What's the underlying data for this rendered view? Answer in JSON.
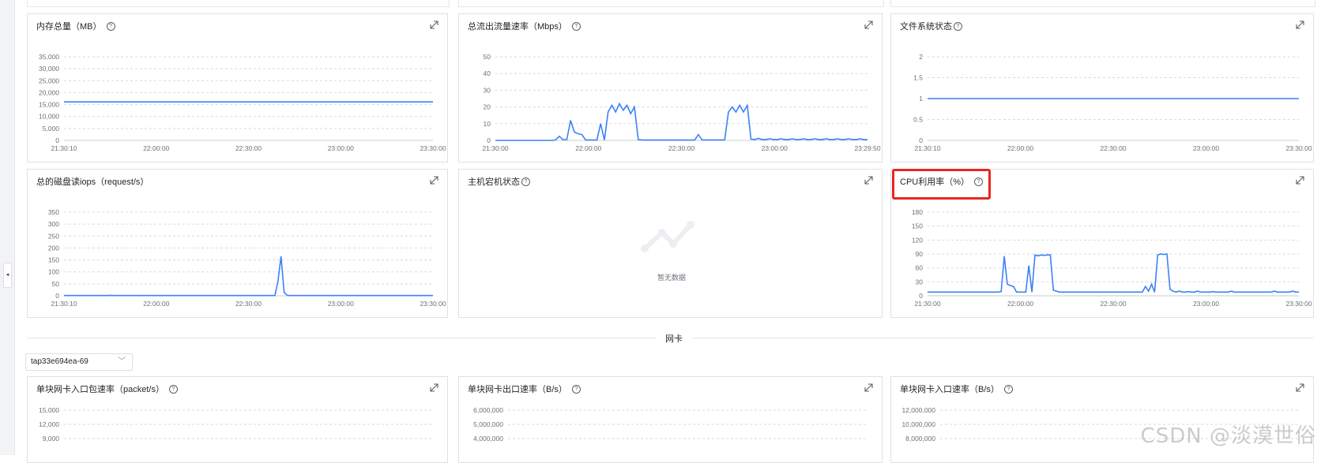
{
  "colors": {
    "line": "#3b82f6",
    "highlight": "#e8261f"
  },
  "section": {
    "label": "网卡"
  },
  "nic_select": {
    "value": "tap33e694ea-69"
  },
  "watermark": {
    "text": "CSDN @淡漠世俗"
  },
  "charts": {
    "memory": {
      "title": "内存总量（MB）",
      "chart_data": {
        "type": "line",
        "yticks": [
          "35,000",
          "30,000",
          "25,000",
          "20,000",
          "15,000",
          "10,000",
          "5,000",
          "0"
        ],
        "xticks": [
          "21:30:10",
          "22:00:00",
          "22:30:00",
          "23:00:00",
          "23:30:00"
        ],
        "ylim": [
          0,
          35000
        ],
        "values": [
          16100,
          16100,
          16100,
          16100,
          16100,
          16100,
          16100,
          16100,
          16100,
          16100
        ]
      }
    },
    "flow_out": {
      "title": "总流出流量速率（Mbps）",
      "chart_data": {
        "type": "line",
        "yticks": [
          "50",
          "40",
          "30",
          "20",
          "10",
          "0"
        ],
        "xticks": [
          "21:30:00",
          "22:00:00",
          "22:30:00",
          "23:00:00",
          "23:29:50"
        ],
        "ylim": [
          0,
          50
        ],
        "values": [
          0,
          0,
          0,
          0,
          0,
          0,
          0,
          0,
          0,
          0,
          0,
          0,
          0,
          0,
          0,
          0,
          0.3,
          2.5,
          0.4,
          0.5,
          12,
          5,
          4,
          3.5,
          0.3,
          0.3,
          0.2,
          0.2,
          10,
          0.3,
          17,
          21,
          17,
          22,
          18,
          21,
          16,
          20,
          0.5,
          0.3,
          0.2,
          0.2,
          0.2,
          0.2,
          0.2,
          0.2,
          0.2,
          0.2,
          0.2,
          0.2,
          0.2,
          0.2,
          0.2,
          0.2,
          3.5,
          0.3,
          0.3,
          0.3,
          0.3,
          0.3,
          0.3,
          0.3,
          17,
          20,
          17,
          21,
          17,
          21,
          0.8,
          0.5,
          1.2,
          0.5,
          0.5,
          1,
          0.5,
          0.5,
          1,
          0.5,
          0.5,
          1,
          0.5,
          0.5,
          1,
          0.5,
          0.5,
          1,
          0.5,
          0.5,
          1,
          0.5,
          0.5,
          1,
          0.5,
          0.5,
          1,
          0.5,
          0.5,
          1,
          0.5,
          0.5
        ]
      }
    },
    "fs_status": {
      "title": "文件系统状态",
      "chart_data": {
        "type": "line",
        "yticks": [
          "2",
          "1.5",
          "1",
          "0.5",
          "0"
        ],
        "xticks": [
          "21:30:10",
          "22:00:00",
          "22:30:00",
          "23:00:00",
          "23:30:00"
        ],
        "ylim": [
          0,
          2
        ],
        "values": [
          1,
          1,
          1,
          1,
          1,
          1,
          1,
          1,
          1,
          1
        ]
      }
    },
    "disk_read_iops": {
      "title": "总的磁盘读iops（request/s）",
      "chart_data": {
        "type": "line",
        "yticks": [
          "350",
          "300",
          "250",
          "200",
          "150",
          "100",
          "50",
          "0"
        ],
        "xticks": [
          "21:30:10",
          "22:00:00",
          "22:30:00",
          "23:00:00",
          "23:30:00"
        ],
        "ylim": [
          0,
          350
        ],
        "values": [
          1,
          1,
          1,
          1,
          1,
          1,
          1,
          1,
          1,
          1,
          1,
          1,
          1,
          1,
          1,
          2,
          1,
          1,
          1,
          1,
          1,
          1,
          1,
          1,
          1,
          1,
          1,
          1,
          1,
          1,
          1,
          1,
          1,
          1,
          1,
          1,
          1,
          1,
          1,
          1,
          1,
          1,
          1,
          1,
          1,
          1,
          1,
          1,
          1,
          1,
          1,
          1,
          1,
          1,
          1,
          1,
          1,
          1,
          1,
          1,
          1,
          1,
          1,
          1,
          1,
          1,
          1,
          1,
          1,
          60,
          165,
          15,
          2,
          1,
          1,
          1,
          1,
          1,
          1,
          1,
          1,
          1,
          1,
          1,
          1,
          1,
          1,
          1,
          1,
          1,
          1,
          1,
          1,
          1,
          1,
          1,
          1,
          1,
          1,
          1,
          1,
          1,
          1,
          1,
          1,
          1,
          1,
          1,
          1,
          1,
          1,
          1,
          1,
          1,
          1,
          1,
          1,
          1,
          1,
          1
        ]
      }
    },
    "host_status": {
      "title": "主机宕机状态",
      "empty_text": "暂无数据"
    },
    "cpu_usage": {
      "title": "CPU利用率（%）",
      "chart_data": {
        "type": "line",
        "yticks": [
          "180",
          "150",
          "120",
          "90",
          "60",
          "30",
          "0"
        ],
        "xticks": [
          "21:30:00",
          "22:00:00",
          "22:30:00",
          "23:00:00",
          "23:30:00"
        ],
        "ylim": [
          0,
          180
        ],
        "values": [
          8,
          8,
          8,
          8,
          8,
          8,
          8,
          8,
          8,
          8,
          8,
          8,
          8,
          8,
          8,
          8,
          8,
          8,
          8,
          8,
          8,
          8,
          8,
          8,
          9,
          85,
          25,
          22,
          20,
          8,
          8,
          8,
          8,
          65,
          8,
          88,
          86,
          88,
          87,
          88,
          88,
          12,
          10,
          8,
          8,
          8,
          8,
          8,
          8,
          8,
          8,
          8,
          8,
          8,
          8,
          8,
          8,
          8,
          8,
          8,
          8,
          8,
          8,
          8,
          8,
          8,
          8,
          8,
          8,
          8,
          8,
          20,
          10,
          25,
          8,
          88,
          90,
          89,
          90,
          14,
          10,
          8,
          10,
          8,
          8,
          9,
          8,
          8,
          10,
          8,
          8,
          8,
          8,
          9,
          8,
          8,
          8,
          8,
          8,
          10,
          8,
          8,
          8,
          8,
          8,
          8,
          8,
          8,
          8,
          8,
          8,
          8,
          8,
          10,
          8,
          8,
          8,
          8,
          8,
          10,
          8,
          8
        ]
      }
    },
    "nic_in_pkts": {
      "title": "单块网卡入口包速率（packet/s）",
      "chart_data": {
        "type": "line",
        "yticks": [
          "15,000",
          "12,000",
          "9,000"
        ],
        "xticks": [],
        "ylim": [
          9000,
          15000
        ],
        "values": []
      }
    },
    "nic_out_rate": {
      "title": "单块网卡出口速率（B/s）",
      "chart_data": {
        "type": "line",
        "yticks": [
          "6,000,000",
          "5,000,000",
          "4,000,000"
        ],
        "xticks": [],
        "ylim": [
          4000000,
          6000000
        ],
        "values": []
      }
    },
    "nic_in_rate": {
      "title": "单块网卡入口速率（B/s）",
      "chart_data": {
        "type": "line",
        "yticks": [
          "12,000,000",
          "10,000,000",
          "8,000,000"
        ],
        "xticks": [],
        "ylim": [
          8000000,
          12000000
        ],
        "values": []
      }
    }
  }
}
